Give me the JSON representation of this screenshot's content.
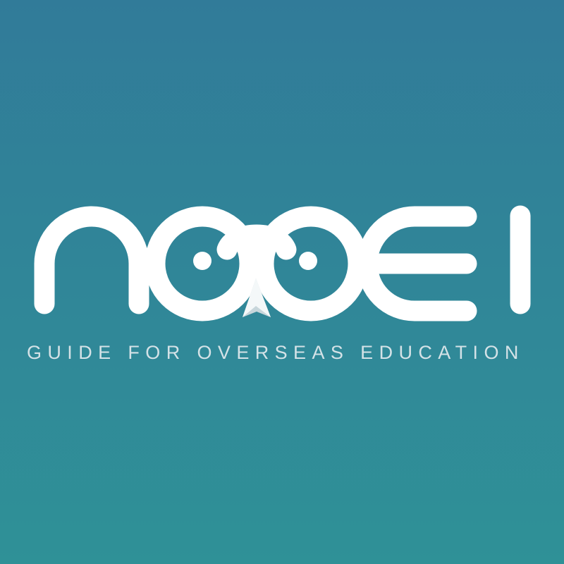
{
  "brand": {
    "tagline": "GUIDE FOR OVERSEAS EDUCATION",
    "logo_icon": "noqei-wordmark-with-glasses-and-paper-plane-icon"
  },
  "colors": {
    "background_top": "#317B99",
    "background_bottom": "#2F9197",
    "logo": "#FFFFFF",
    "tagline": "#D4E2E7",
    "plane_light": "#F4F8F9",
    "plane_shadow": "#C7D6DB"
  }
}
